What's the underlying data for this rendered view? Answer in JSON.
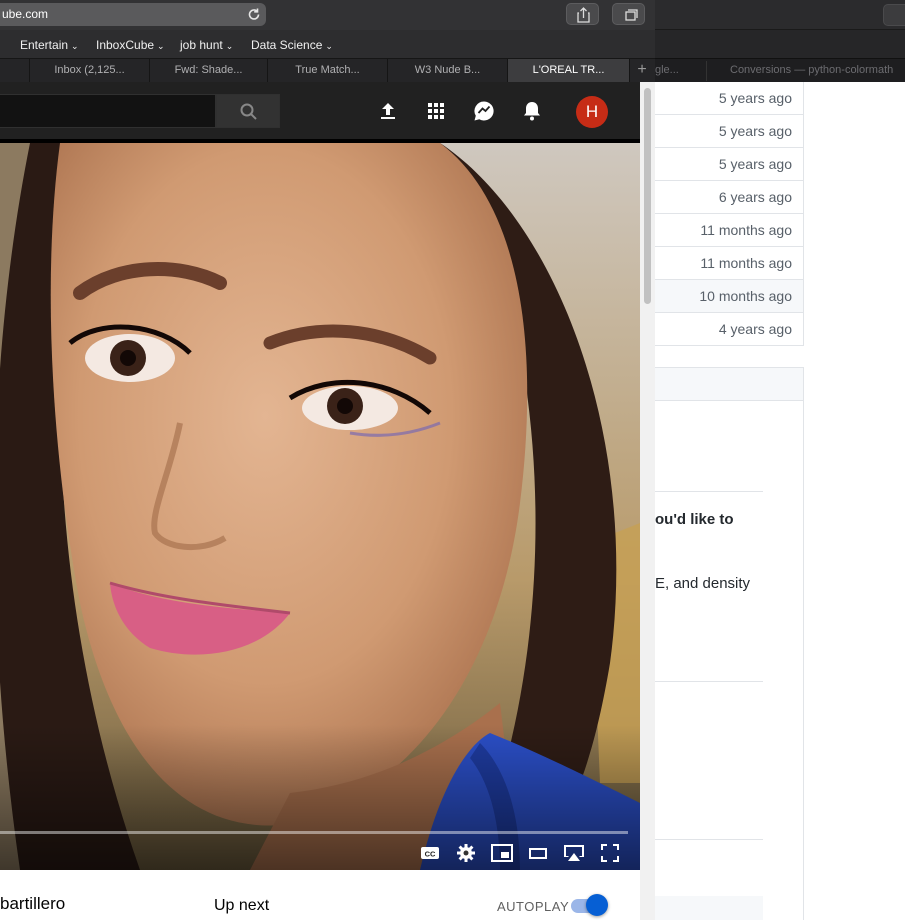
{
  "browser": {
    "url": "ube.com",
    "bookmarks": [
      {
        "label": "Entertain"
      },
      {
        "label": "InboxCube"
      },
      {
        "label": "job hunt"
      },
      {
        "label": "Data Science"
      }
    ],
    "tabs": [
      {
        "label": ""
      },
      {
        "label": "Inbox (2,125..."
      },
      {
        "label": "Fwd: Shade..."
      },
      {
        "label": "True Match..."
      },
      {
        "label": "W3 Nude B..."
      },
      {
        "label": "L'OREAL TR..."
      }
    ],
    "new_tab_symbol": "+"
  },
  "background_window": {
    "tabs": [
      {
        "label": "gle..."
      },
      {
        "label": "Conversions — python-colormath"
      }
    ],
    "commit_ages": [
      "5 years ago",
      "5 years ago",
      "5 years ago",
      "6 years ago",
      "11 months ago",
      "11 months ago",
      "10 months ago",
      "4 years ago"
    ],
    "highlighted_row": 6,
    "bold_text": "ou'd like to",
    "body_text": "E, and density"
  },
  "youtube": {
    "avatar_initial": "H",
    "channel_name": "bartillero",
    "up_next_label": "Up next",
    "autoplay_label": "AUTOPLAY",
    "autoplay_on": true,
    "icons": {
      "upload": "upload-icon",
      "apps": "apps-grid-icon",
      "messages": "messages-icon",
      "notifications": "bell-icon",
      "search": "search-icon"
    },
    "colors": {
      "avatar": "#c62c16",
      "autoplay": "#065fd4",
      "header": "#212121"
    }
  }
}
